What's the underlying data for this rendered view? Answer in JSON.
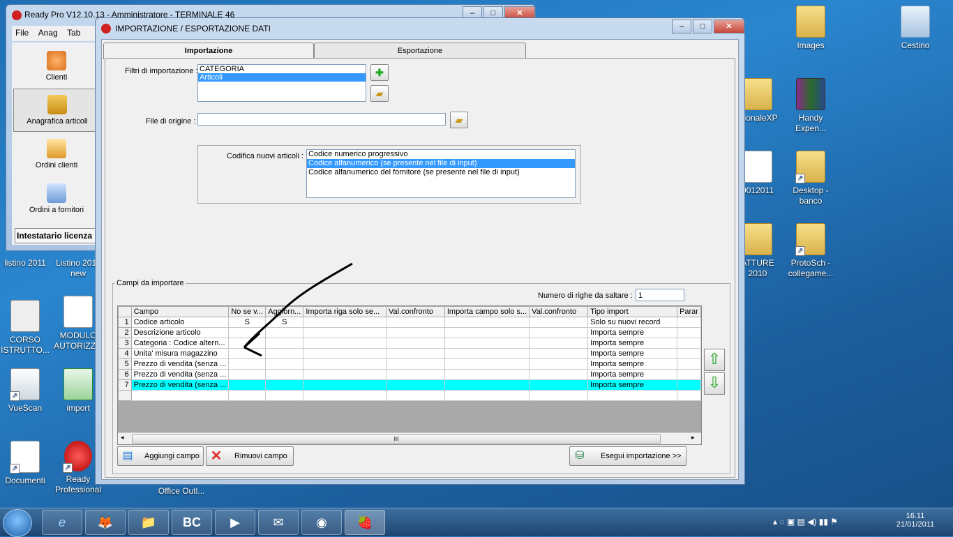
{
  "desktop": {
    "icons": [
      {
        "label": "Images"
      },
      {
        "label": "Cestino"
      },
      {
        "label": "ctionaleXP"
      },
      {
        "label": "Handy Expen..."
      },
      {
        "label": "9012011"
      },
      {
        "label": "Desktop - banco"
      },
      {
        "label": "ATTURE 2010"
      },
      {
        "label": "ProtoSch - collegame..."
      },
      {
        "label": "listino 2011"
      },
      {
        "label": "Listino 2011 new"
      },
      {
        "label": "CORSO ISTRUTTO..."
      },
      {
        "label": "MODULO AUTORIZZ..."
      },
      {
        "label": "VueScan"
      },
      {
        "label": "import"
      },
      {
        "label": "Documenti"
      },
      {
        "label": "Ready Professional"
      },
      {
        "label": "Office Outl..."
      }
    ]
  },
  "readypro": {
    "title": "Ready Pro V12.10.13 - Amministratore - TERMINALE 46",
    "menu": [
      "File",
      "Anag",
      "Tab"
    ],
    "side": [
      "Clienti",
      "Anagrafica articoli",
      "Ordini clienti",
      "Ordini a fornitori"
    ],
    "license": "Intestatario licenza"
  },
  "dialog": {
    "title": "IMPORTAZIONE / ESPORTAZIONE DATI",
    "tabs": [
      "Importazione",
      "Esportazione"
    ],
    "filters_label": "Filtri di importazione :",
    "filters": [
      "CATEGORIA",
      "Articoli"
    ],
    "source_label": "File di origine :",
    "source_value": "",
    "coding_label": "Codifica nuovi articoli :",
    "coding_options": [
      "Codice numerico progressivo",
      "Codice alfanumerico (se presente nel file di input)",
      "Codice alfanumerico del fornitore (se presente nel file di input)"
    ],
    "fields_group": "Campi da importare",
    "skip_label": "Numero di righe da saltare :",
    "skip_value": "1",
    "grid": {
      "headers": [
        "Campo",
        "No se v...",
        "Aggiorn...",
        "Importa riga solo se...",
        "Val.confronto",
        "Importa campo solo s...",
        "Val.confronto",
        "Tipo import",
        "Parar"
      ],
      "rows": [
        {
          "n": "1",
          "campo": "Codice articolo",
          "c2": "S",
          "c3": "S",
          "tipo": "Solo su nuovi record"
        },
        {
          "n": "2",
          "campo": "Descrizione articolo",
          "c2": "",
          "c3": "",
          "tipo": "Importa sempre"
        },
        {
          "n": "3",
          "campo": "Categoria : Codice altern...",
          "c2": "",
          "c3": "",
          "tipo": "Importa sempre"
        },
        {
          "n": "4",
          "campo": "Unita' misura magazzino",
          "c2": "",
          "c3": "",
          "tipo": "Importa sempre"
        },
        {
          "n": "5",
          "campo": "Prezzo di vendita (senza ...",
          "c2": "",
          "c3": "",
          "tipo": "Importa sempre"
        },
        {
          "n": "6",
          "campo": "Prezzo di vendita (senza ...",
          "c2": "",
          "c3": "",
          "tipo": "Importa sempre"
        },
        {
          "n": "7",
          "campo": "Prezzo di vendita (senza ...",
          "c2": "",
          "c3": "",
          "tipo": "Importa sempre"
        }
      ],
      "scroll_grip": "III"
    },
    "buttons": {
      "add": "Aggiungi campo",
      "remove": "Rimuovi campo",
      "run": "Esegui importazione >>"
    }
  },
  "taskbar": {
    "time": "16.11",
    "date": "21/01/2011",
    "items": [
      "e",
      "🦊",
      "📁",
      "BC",
      "▶",
      "✉",
      "◉",
      "🍓"
    ]
  }
}
